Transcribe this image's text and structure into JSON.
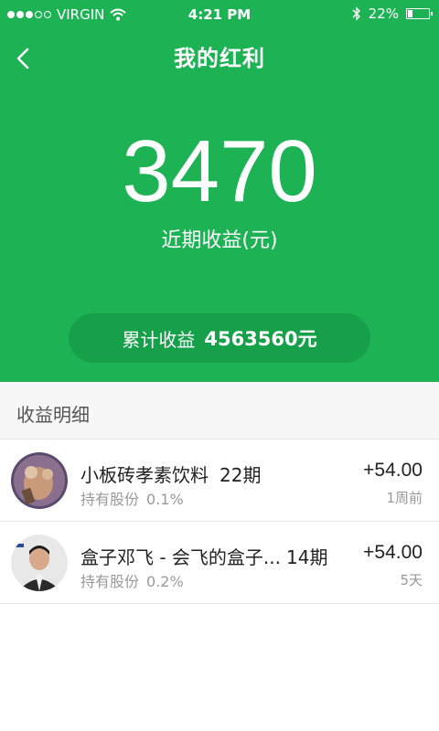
{
  "status_bar": {
    "carrier": "VIRGIN",
    "time": "4:21 PM",
    "battery": "22%",
    "battery_level": 0.22,
    "signal_bars_filled": 3,
    "signal_bars_total": 5
  },
  "nav": {
    "title": "我的红利",
    "back_icon": "chevron-left-icon"
  },
  "summary": {
    "recent_amount": "3470",
    "recent_label": "近期收益(元)",
    "total_label": "累计收益",
    "total_value": "4563560元"
  },
  "detail": {
    "section_title": "收益明细",
    "items": [
      {
        "name": "小板砖孝素饮料",
        "period": "22期",
        "share_label": "持有股份",
        "share_value": "0.1%",
        "amount": "+54.00",
        "time": "1周前"
      },
      {
        "name": "盒子邓飞 - 会飞的盒子...",
        "period": "14期",
        "share_label": "持有股份",
        "share_value": "0.2%",
        "amount": "+54.00",
        "time": "5天"
      }
    ]
  },
  "colors": {
    "primary": "#1db254",
    "pill": "#17a04a"
  }
}
